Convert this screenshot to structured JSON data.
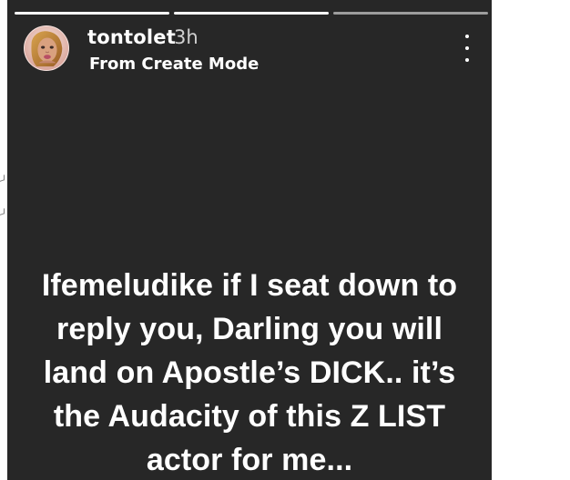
{
  "story": {
    "progress": [
      1.0,
      1.0,
      0.0
    ],
    "username": "tontolet",
    "timestamp": "3h",
    "subtitle": "From Create Mode",
    "menu_icon": "more-vertical-icon",
    "caption": "Ifemeludike if I seat down to reply you, Darling you will land on Apostle’s DICK.. it’s the Audacity of this Z LIST actor for me..."
  },
  "colors": {
    "background": "#272727",
    "text": "#ffffff"
  }
}
